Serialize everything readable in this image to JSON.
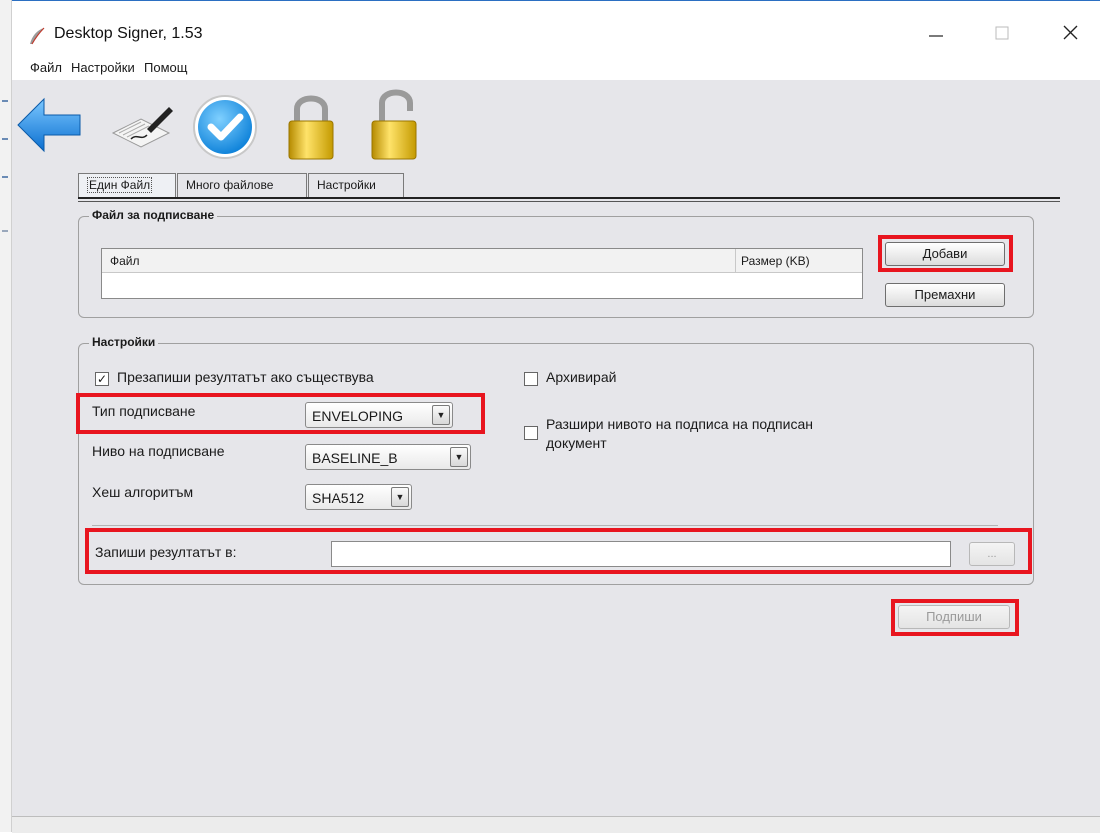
{
  "window": {
    "title": "Desktop Signer, 1.53"
  },
  "menubar": {
    "items": [
      "Файл",
      "Настройки",
      "Помощ"
    ]
  },
  "toolbar": {
    "icons": [
      "back-arrow-icon",
      "sign-document-icon",
      "verify-checkmark-icon",
      "lock-closed-icon",
      "lock-open-icon"
    ]
  },
  "tabs": [
    "Един Файл",
    "Много файлове",
    "Настройки"
  ],
  "file_group": {
    "title": "Файл за подписване",
    "columns": [
      "Файл",
      "Размер (KB)"
    ],
    "rows": [],
    "add_label": "Добави",
    "remove_label": "Премахни"
  },
  "settings_group": {
    "title": "Настройки",
    "overwrite_label": "Презапиши резултатът ако съществува",
    "overwrite_checked": true,
    "archive_label": "Архивирай",
    "archive_checked": false,
    "extend_label_line1": "Разшири нивото на подписа на подписан",
    "extend_label_line2": "документ",
    "extend_checked": false,
    "sign_type_label": "Тип подписване",
    "sign_type_value": "ENVELOPING",
    "sign_level_label": "Ниво на подписване",
    "sign_level_value": "BASELINE_B",
    "hash_label": "Хеш алгоритъм",
    "hash_value": "SHA512",
    "output_label": "Запиши резултатът в:",
    "output_value": "",
    "browse_label": "..."
  },
  "sign_button_label": "Подпиши",
  "colors": {
    "highlight": "#e8151f",
    "window_bg": "#e6e6ea",
    "accent_blue": "#1f8fe0"
  }
}
